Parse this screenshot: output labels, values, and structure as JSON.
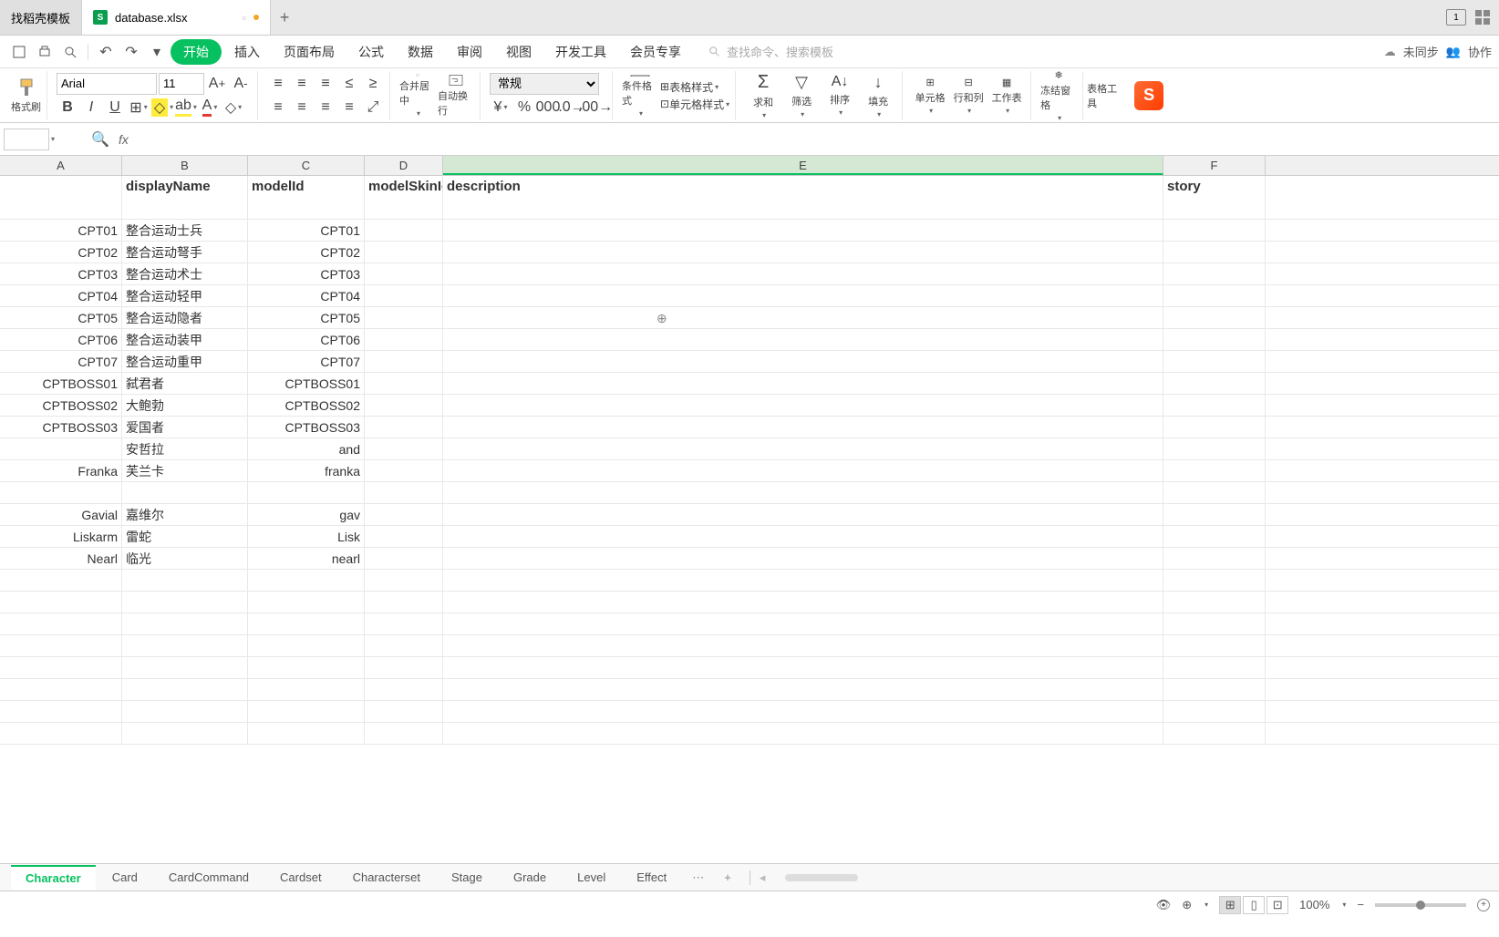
{
  "titlebar": {
    "tab1": "找稻壳模板",
    "tab2": "database.xlsx",
    "tab2_badge": "1"
  },
  "menu": {
    "start": "开始",
    "insert": "插入",
    "layout": "页面布局",
    "formula": "公式",
    "data": "数据",
    "review": "审阅",
    "view": "视图",
    "dev": "开发工具",
    "vip": "会员专享",
    "search_placeholder": "查找命令、搜索模板",
    "unsync": "未同步",
    "collab": "协作"
  },
  "ribbon": {
    "format_painter": "格式刷",
    "font_name": "Arial",
    "font_size": "11",
    "merge": "合并居中",
    "wrap": "自动换行",
    "number_format": "常规",
    "cond_format": "条件格式",
    "table_style": "表格样式",
    "cell_style": "单元格样式",
    "sum": "求和",
    "filter": "筛选",
    "sort": "排序",
    "fill": "填充",
    "cell": "单元格",
    "rowcol": "行和列",
    "sheet": "工作表",
    "freeze": "冻结窗格",
    "table_tools": "表格工具"
  },
  "columns": {
    "A": "A",
    "B": "B",
    "C": "C",
    "D": "D",
    "E": "E",
    "F": "F"
  },
  "headers": {
    "displayName": "displayName",
    "modelId": "modelId",
    "modelSkinId": "modelSkinId",
    "description": "description",
    "story": "story"
  },
  "rows": [
    {
      "a": "CPT01",
      "b": "整合运动士兵",
      "c": "CPT01"
    },
    {
      "a": "CPT02",
      "b": "整合运动弩手",
      "c": "CPT02"
    },
    {
      "a": "CPT03",
      "b": "整合运动术士",
      "c": "CPT03"
    },
    {
      "a": "CPT04",
      "b": "整合运动轻甲",
      "c": "CPT04"
    },
    {
      "a": "CPT05",
      "b": "整合运动隐者",
      "c": "CPT05"
    },
    {
      "a": "CPT06",
      "b": "整合运动装甲",
      "c": "CPT06"
    },
    {
      "a": "CPT07",
      "b": "整合运动重甲",
      "c": "CPT07"
    },
    {
      "a": "CPTBOSS01",
      "b": "弑君者",
      "c": "CPTBOSS01"
    },
    {
      "a": "CPTBOSS02",
      "b": "大鲍勃",
      "c": "CPTBOSS02"
    },
    {
      "a": "CPTBOSS03",
      "b": "爱国者",
      "c": "CPTBOSS03"
    },
    {
      "a": "",
      "b": "安哲拉",
      "c": "and"
    },
    {
      "a": "Franka",
      "b": "芙兰卡",
      "c": "franka"
    },
    {
      "a": "",
      "b": "",
      "c": ""
    },
    {
      "a": "Gavial",
      "b": "嘉维尔",
      "c": "gav"
    },
    {
      "a": "Liskarm",
      "b": "雷蛇",
      "c": "Lisk"
    },
    {
      "a": "Nearl",
      "b": "临光",
      "c": "nearl"
    }
  ],
  "sheets": {
    "character": "Character",
    "card": "Card",
    "cardcommand": "CardCommand",
    "cardset": "Cardset",
    "characterset": "Characterset",
    "stage": "Stage",
    "grade": "Grade",
    "level": "Level",
    "effect": "Effect"
  },
  "status": {
    "zoom": "100%"
  }
}
